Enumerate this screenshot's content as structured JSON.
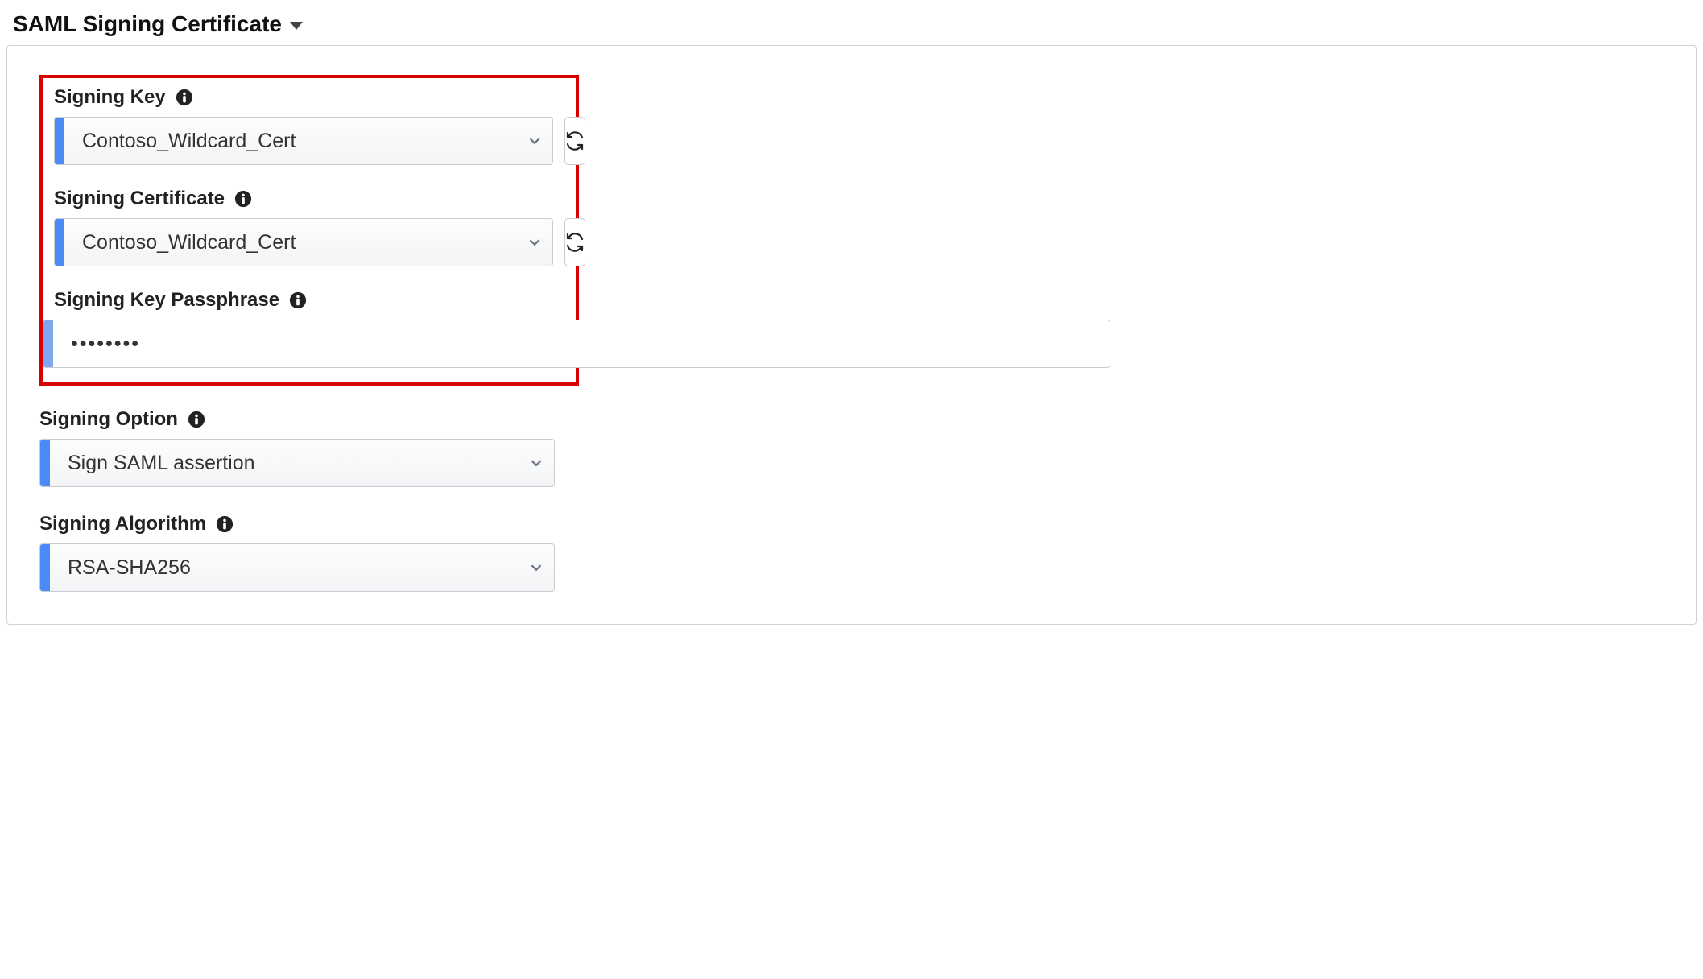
{
  "section": {
    "title": "SAML Signing Certificate"
  },
  "fields": {
    "signing_key": {
      "label": "Signing Key",
      "value": "Contoso_Wildcard_Cert"
    },
    "signing_certificate": {
      "label": "Signing Certificate",
      "value": "Contoso_Wildcard_Cert"
    },
    "signing_key_passphrase": {
      "label": "Signing Key Passphrase",
      "value": "••••••••"
    },
    "signing_option": {
      "label": "Signing Option",
      "value": "Sign SAML assertion"
    },
    "signing_algorithm": {
      "label": "Signing Algorithm",
      "value": "RSA-SHA256"
    }
  }
}
